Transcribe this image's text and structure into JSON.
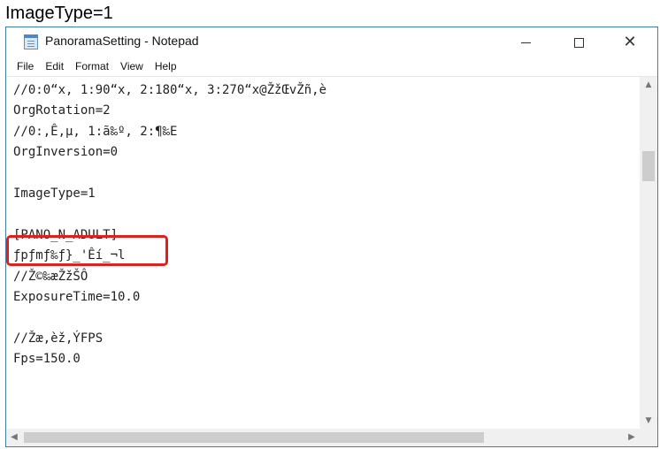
{
  "caption": "ImageType=1",
  "window": {
    "title": "PanoramaSetting - Notepad",
    "controls": {
      "minimize": "minimize",
      "maximize": "maximize",
      "close": "✕"
    }
  },
  "menu": [
    {
      "label": "File"
    },
    {
      "label": "Edit"
    },
    {
      "label": "Format"
    },
    {
      "label": "View"
    },
    {
      "label": "Help"
    }
  ],
  "lines": [
    "//0:0“x, 1:90“x, 2:180“x, 3:270“x@ŽžŒvŽñ,è",
    "OrgRotation=2",
    "//0:,Ê,µ, 1:ã‰º, 2:¶‰E",
    "OrgInversion=0",
    "",
    "ImageType=1",
    "",
    "[PANO_N_ADULT]",
    "ƒpƒmƒ‰ƒ}_'Êí_¬l",
    "//Ž©‰æŽžŠÔ",
    "ExposureTime=10.0",
    "",
    "//Žæ,èž,ÝFPS",
    "Fps=150.0"
  ],
  "scroll_icons": {
    "up": "chevron-up-icon",
    "down": "chevron-down-icon",
    "left": "chevron-left-icon",
    "right": "chevron-right-icon"
  },
  "accent_colors": {
    "highlight": "#e0201c",
    "window_border": "#3c7fb1"
  }
}
